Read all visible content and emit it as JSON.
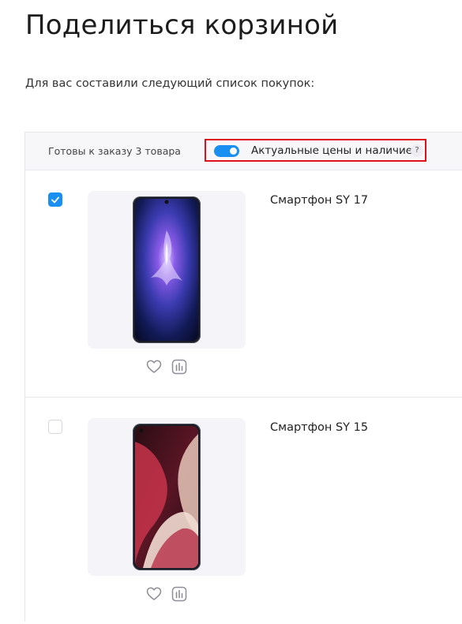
{
  "page": {
    "title": "Поделиться корзиной",
    "subtitle": "Для вас составили следующий список покупок:"
  },
  "cart": {
    "ready_label": "Готовы к заказу 3 товара",
    "toggle": {
      "label": "Актуальные цены и наличие",
      "on": true,
      "help_glyph": "?"
    }
  },
  "products": [
    {
      "name": "Смартфон SY 17",
      "checked": true,
      "icons": [
        "heart-icon",
        "compare-chart-icon"
      ]
    },
    {
      "name": "Смартфон SY 15",
      "checked": false,
      "icons": [
        "heart-icon",
        "compare-chart-icon"
      ]
    }
  ],
  "colors": {
    "accent": "#1a8ff2",
    "highlight_border": "#e0101a",
    "image_bg": "#f4f4f9"
  }
}
